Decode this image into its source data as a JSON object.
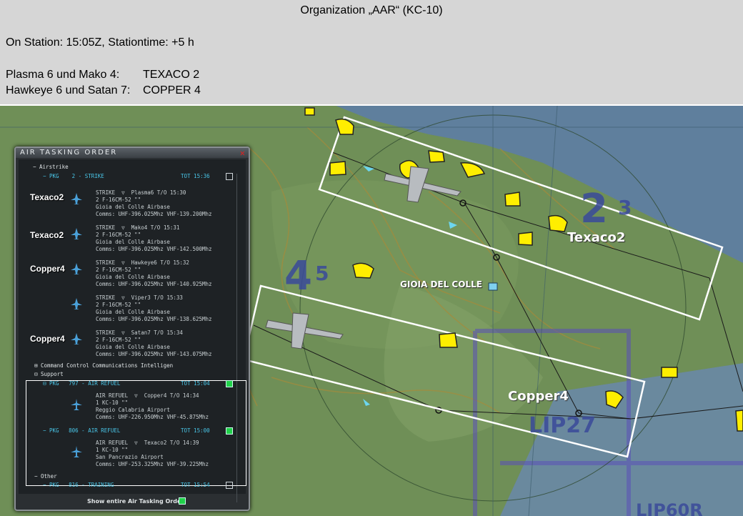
{
  "slide": {
    "title": "Organization „AAR“ (KC-10)",
    "on_station": "On Station: 15:05Z, Stationtime: +5 h",
    "assignments": [
      {
        "label": "Plasma 6 und Mako 4:",
        "value": "TEXACO 2"
      },
      {
        "label": "Hawkeye 6 und Satan 7:",
        "value": "COPPER 4"
      }
    ]
  },
  "map": {
    "track_labels": {
      "texaco": "Texaco2",
      "copper": "Copper4"
    },
    "airbase_label": "GIOIA DEL COLLE",
    "region_numbers": [
      "2",
      "3",
      "4",
      "5"
    ],
    "area_code_1": "LIP27",
    "area_code_2": "LIP60R"
  },
  "ato": {
    "title": "AIR TASKING ORDER",
    "close_icon": "close-icon",
    "airstrike_label": "Airstrike",
    "strike_pkg": {
      "pkg": "PKG",
      "name": "2 - STRIKE",
      "tot": "TOT 15:36"
    },
    "strike_missions": [
      {
        "side_label": "Texaco2",
        "type": "STRIKE",
        "callsign": "Plasma6",
        "to": "T/O 15:30",
        "aircraft": "2 F-16CM-52",
        "base": "Gioia del Colle Airbase",
        "comms": "Comms: UHF-396.025Mhz VHF-139.200Mhz"
      },
      {
        "side_label": "Texaco2",
        "type": "STRIKE",
        "callsign": "Mako4",
        "to": "T/O 15:31",
        "aircraft": "2 F-16CM-52",
        "base": "Gioia del Colle Airbase",
        "comms": "Comms: UHF-396.025Mhz VHF-142.500Mhz"
      },
      {
        "side_label": "Copper4",
        "type": "STRIKE",
        "callsign": "Hawkeye6",
        "to": "T/O 15:32",
        "aircraft": "2 F-16CM-52",
        "base": "Gioia del Colle Airbase",
        "comms": "Comms: UHF-396.025Mhz VHF-140.925Mhz"
      },
      {
        "side_label": "",
        "type": "STRIKE",
        "callsign": "Viper3",
        "to": "T/O 15:33",
        "aircraft": "2 F-16CM-52",
        "base": "Gioia del Colle Airbase",
        "comms": "Comms: UHF-396.025Mhz VHF-138.625Mhz"
      },
      {
        "side_label": "Copper4",
        "type": "STRIKE",
        "callsign": "Satan7",
        "to": "T/O 15:34",
        "aircraft": "2 F-16CM-52",
        "base": "Gioia del Colle Airbase",
        "comms": "Comms: UHF-396.025Mhz VHF-143.075Mhz"
      }
    ],
    "ccci_label": "Command Control Communications Intelligen",
    "support_label": "Support",
    "support_pkgs": [
      {
        "pkg": "PKG",
        "name": "797 - AIR REFUEL",
        "tot": "TOT 15:04",
        "type": "AIR REFUEL",
        "callsign": "Copper4",
        "to": "T/O 14:34",
        "aircraft": "1 KC-10",
        "base": "Reggio Calabria Airport",
        "comms": "Comms: UHF-226.950Mhz VHF-45.875Mhz"
      },
      {
        "pkg": "PKG",
        "name": "806 - AIR REFUEL",
        "tot": "TOT 15:00",
        "type": "AIR REFUEL",
        "callsign": "Texaco2",
        "to": "T/O 14:39",
        "aircraft": "1 KC-10",
        "base": "San Pancrazio Airport",
        "comms": "Comms: UHF-253.325Mhz VHF-39.225Mhz"
      }
    ],
    "other_label": "Other",
    "training_pkg": {
      "pkg": "PKG",
      "name": "816 - TRAINING",
      "tot": "TOT 15:54"
    },
    "show_entire": "Show entire Air Tasking Order"
  },
  "colors": {
    "pkg_cyan": "#49c6e8",
    "check_green": "#21d14a",
    "zone_yellow": "#ffee00",
    "route_white": "#ffffff"
  }
}
